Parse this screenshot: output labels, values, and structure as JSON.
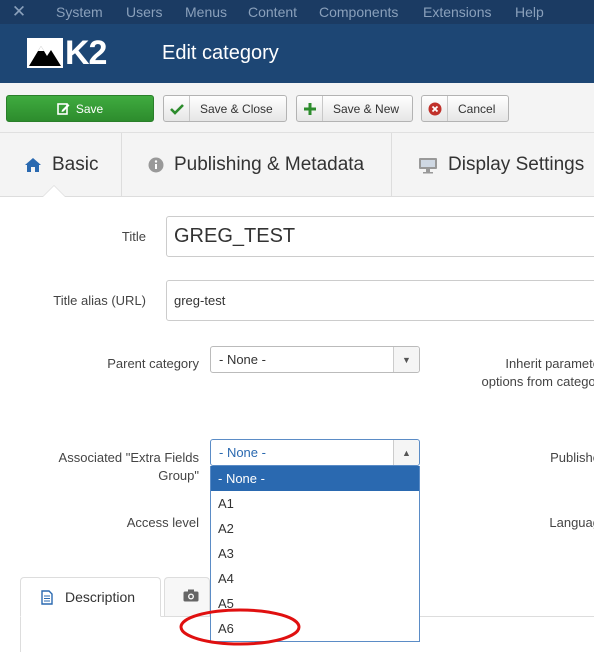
{
  "topmenu": {
    "logo_icon": "joomla-icon",
    "items": [
      "System",
      "Users",
      "Menus",
      "Content",
      "Components",
      "Extensions",
      "Help"
    ]
  },
  "header": {
    "logo_text": "K2",
    "title": "Edit category"
  },
  "toolbar": {
    "save_label": "Save",
    "save_close_label": "Save & Close",
    "save_new_label": "Save & New",
    "cancel_label": "Cancel"
  },
  "tabs": [
    {
      "label": "Basic",
      "icon": "home-icon"
    },
    {
      "label": "Publishing & Metadata",
      "icon": "info-icon"
    },
    {
      "label": "Display Settings",
      "icon": "monitor-icon"
    }
  ],
  "form": {
    "title_label": "Title",
    "title_value": "GREG_TEST",
    "alias_label": "Title alias (URL)",
    "alias_value": "greg-test",
    "parent_label": "Parent category",
    "parent_value": "- None -",
    "inherit_label_line1": "Inherit paramete",
    "inherit_label_line2": "options from categor",
    "extra_label_line1": "Associated \"Extra Fields",
    "extra_label_line2": "Group\"",
    "extra_value": "- None -",
    "published_label": "Publishe",
    "access_label": "Access level",
    "language_label": "Languag"
  },
  "dropdown": {
    "options": [
      "- None -",
      "A1",
      "A2",
      "A3",
      "A4",
      "A5",
      "A6"
    ],
    "selected": "- None -"
  },
  "bottom_tabs": {
    "description_label": "Description"
  },
  "colors": {
    "topbar": "#1b3b63",
    "titlebar": "#1d4674",
    "save_green": "#2d8c2d",
    "accent_blue": "#2a69b0",
    "annotation_red": "#e01010"
  }
}
